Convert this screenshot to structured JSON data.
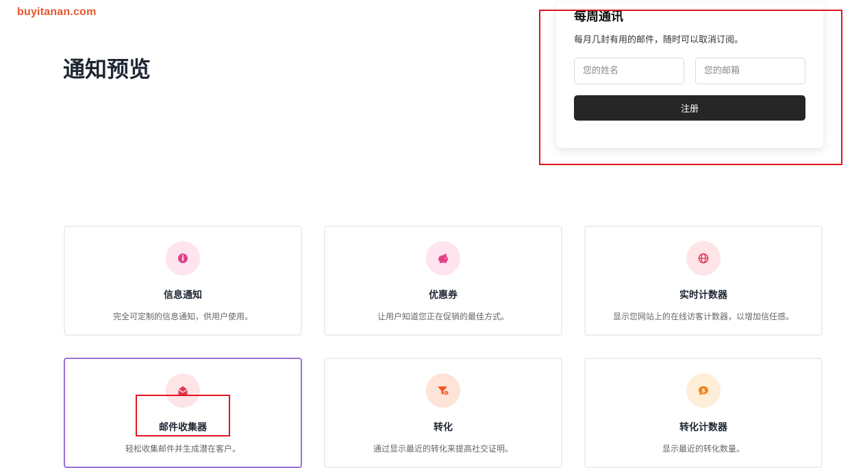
{
  "watermark": "buyitanan.com",
  "page_title": "通知预览",
  "newsletter": {
    "title": "每周通讯",
    "subtitle": "每月几封有用的邮件，随时可以取消订阅。",
    "name_placeholder": "您的姓名",
    "email_placeholder": "您的邮箱",
    "submit_label": "注册"
  },
  "colors": {
    "accent_button": "#262626",
    "active_card_border": "#9b6fd6",
    "highlight_red": "#e0141e"
  },
  "cards": [
    {
      "title": "信息通知",
      "desc": "完全可定制的信息通知，供用户使用。",
      "icon": "info-icon",
      "icon_bg": "#fde4ef",
      "icon_color": "#e2418a"
    },
    {
      "title": "优惠券",
      "desc": "让用户知道您正在促销的最佳方式。",
      "icon": "piggy-bank-icon",
      "icon_bg": "#fde4ef",
      "icon_color": "#e2418a"
    },
    {
      "title": "实时计数器",
      "desc": "显示您网站上的在线访客计数器，以增加信任感。",
      "icon": "globe-icon",
      "icon_bg": "#fde4e6",
      "icon_color": "#e33a52"
    },
    {
      "title": "邮件收集器",
      "desc": "轻松收集邮件并生成潜在客户。",
      "icon": "envelope-open-icon",
      "icon_bg": "#fde4e6",
      "icon_color": "#e33a52"
    },
    {
      "title": "转化",
      "desc": "通过显示最近的转化来提高社交证明。",
      "icon": "funnel-dollar-icon",
      "icon_bg": "#fde3d8",
      "icon_color": "#ef5a26"
    },
    {
      "title": "转化计数器",
      "desc": "显示最近的转化数量。",
      "icon": "comment-dollar-icon",
      "icon_bg": "#feeed8",
      "icon_color": "#f0851a"
    }
  ]
}
